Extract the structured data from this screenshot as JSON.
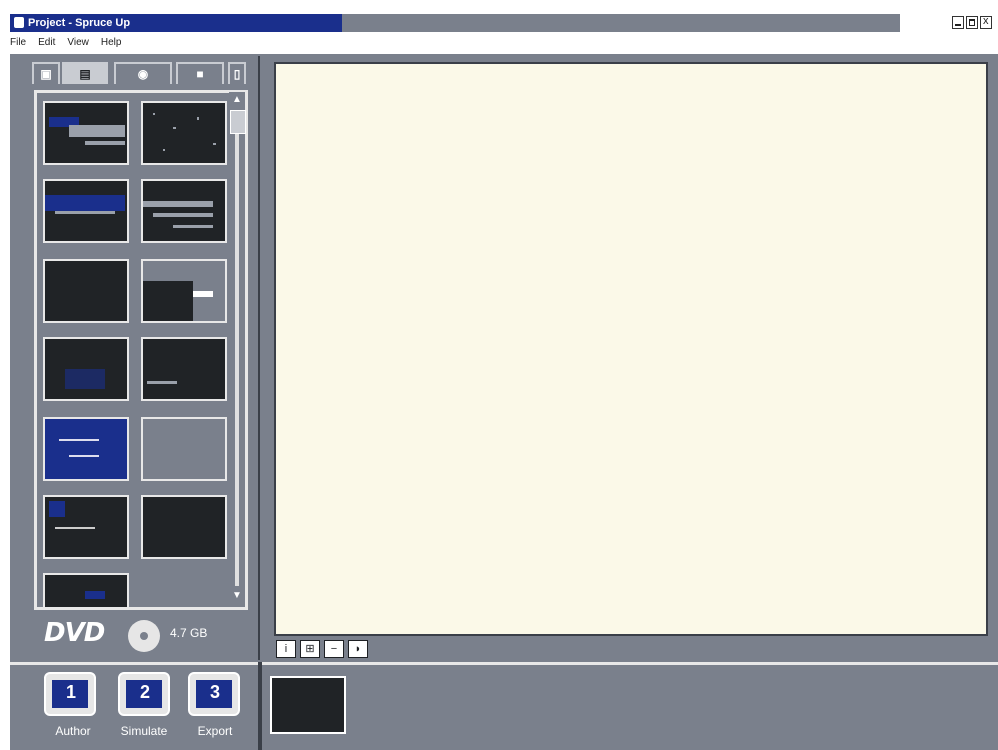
{
  "window": {
    "title": "Project - Spruce Up",
    "controls": [
      "minimize",
      "maximize",
      "close"
    ]
  },
  "menu": {
    "items": [
      "File",
      "Edit",
      "View",
      "Help"
    ]
  },
  "tabs": [
    {
      "icon": "media-icon",
      "active": false
    },
    {
      "icon": "image-icon",
      "active": true
    },
    {
      "icon": "clock-icon",
      "active": false
    },
    {
      "icon": "disk-icon",
      "active": false
    },
    {
      "icon": "page-icon",
      "active": false
    }
  ],
  "thumbnails": [
    {
      "style": "dark"
    },
    {
      "style": "dark"
    },
    {
      "style": "dark"
    },
    {
      "style": "dark"
    },
    {
      "style": "dark"
    },
    {
      "style": "dark"
    },
    {
      "style": "dark"
    },
    {
      "style": "dark"
    },
    {
      "style": "blue"
    },
    {
      "style": "grey"
    },
    {
      "style": "dark"
    },
    {
      "style": "dark"
    },
    {
      "style": "dark"
    }
  ],
  "disc": {
    "format": "DVD",
    "capacity": "4.7 GB"
  },
  "view_buttons": [
    "info-icon",
    "grid-icon",
    "minus-icon",
    "speaker-icon"
  ],
  "nav": [
    {
      "label": "Author",
      "num": "1"
    },
    {
      "label": "Simulate",
      "num": "2"
    },
    {
      "label": "Export",
      "num": "3"
    }
  ],
  "colors": {
    "panel": "#7a808c",
    "title_active": "#1a2f8c",
    "preview": "#fbf9e8",
    "accent_blue": "#1a2f8c"
  }
}
